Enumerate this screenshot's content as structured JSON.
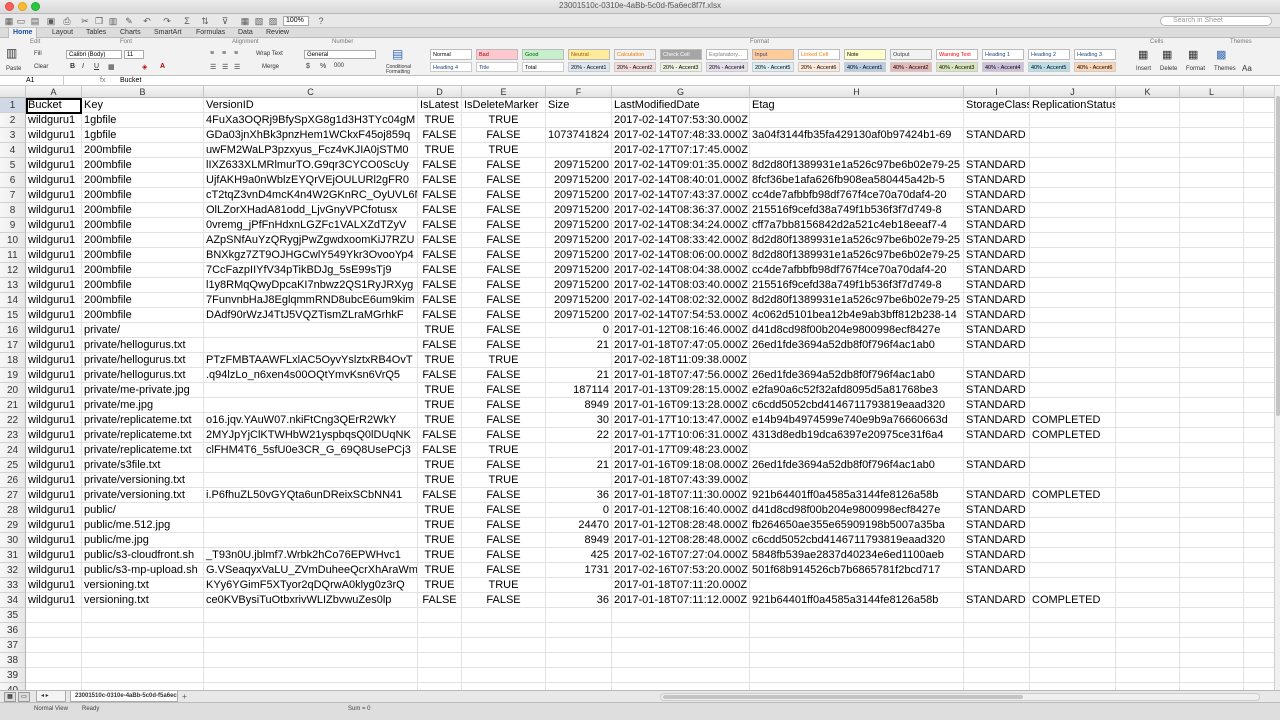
{
  "window": {
    "title": "23001510c-0310e-4aBb-5c0d-f5a6ec8f7f.xlsx"
  },
  "toolbar": {
    "zoom": "100%",
    "search_placeholder": "Search in Sheet"
  },
  "tabs": [
    "Home",
    "Layout",
    "Tables",
    "Charts",
    "SmartArt",
    "Formulas",
    "Data",
    "Review"
  ],
  "ribbon": {
    "groups": [
      "Edit",
      "Font",
      "Alignment",
      "Number",
      "Format",
      "Cells",
      "Themes"
    ],
    "paste": "Paste",
    "fill": "Fill",
    "clear": "Clear",
    "font_name": "Calibri (Body)",
    "font_size": "11",
    "wrap_text": "Wrap Text",
    "merge": "Merge",
    "number_format": "General",
    "conditional": "Conditional Formatting",
    "cells_buttons": [
      "Insert",
      "Delete",
      "Format"
    ],
    "themes_buttons": [
      "Themes",
      "Aa"
    ],
    "styles_top": [
      {
        "label": "Normal",
        "bg": "#ffffff",
        "fg": "#000000"
      },
      {
        "label": "Bad",
        "bg": "#ffc7ce",
        "fg": "#9c0006"
      },
      {
        "label": "Good",
        "bg": "#c6efce",
        "fg": "#006100"
      },
      {
        "label": "Neutral",
        "bg": "#ffeb9c",
        "fg": "#9c5700"
      },
      {
        "label": "Calculation",
        "bg": "#f2f2f2",
        "fg": "#fa7d00"
      },
      {
        "label": "Check Cell",
        "bg": "#a5a5a5",
        "fg": "#ffffff"
      },
      {
        "label": "Explanatory...",
        "bg": "#ffffff",
        "fg": "#7f7f7f"
      },
      {
        "label": "Input",
        "bg": "#ffcc99",
        "fg": "#3f3f76"
      },
      {
        "label": "Linked Cell",
        "bg": "#ffffff",
        "fg": "#fa7d00"
      },
      {
        "label": "Note",
        "bg": "#ffffcc",
        "fg": "#000000"
      },
      {
        "label": "Output",
        "bg": "#f2f2f2",
        "fg": "#3f3f3f"
      },
      {
        "label": "Warning Text",
        "bg": "#ffffff",
        "fg": "#ff0000"
      },
      {
        "label": "Heading 1",
        "bg": "#ffffff",
        "fg": "#1f497d"
      },
      {
        "label": "Heading 2",
        "bg": "#ffffff",
        "fg": "#1f497d"
      },
      {
        "label": "Heading 3",
        "bg": "#ffffff",
        "fg": "#1f497d"
      }
    ],
    "styles_bottom": [
      {
        "label": "Heading 4",
        "bg": "#ffffff",
        "fg": "#1f497d"
      },
      {
        "label": "Title",
        "bg": "#ffffff",
        "fg": "#1f497d"
      },
      {
        "label": "Total",
        "bg": "#ffffff",
        "fg": "#000000"
      },
      {
        "label": "20% - Accent1",
        "bg": "#dce6f1",
        "fg": "#000000"
      },
      {
        "label": "20% - Accent2",
        "bg": "#f2dcdb",
        "fg": "#000000"
      },
      {
        "label": "20% - Accent3",
        "bg": "#ebf1de",
        "fg": "#000000"
      },
      {
        "label": "20% - Accent4",
        "bg": "#e4dfec",
        "fg": "#000000"
      },
      {
        "label": "20% - Accent5",
        "bg": "#daeef3",
        "fg": "#000000"
      },
      {
        "label": "20% - Accent6",
        "bg": "#fde9d9",
        "fg": "#000000"
      },
      {
        "label": "40% - Accent1",
        "bg": "#b8cce4",
        "fg": "#000000"
      },
      {
        "label": "40% - Accent2",
        "bg": "#e6b8b7",
        "fg": "#000000"
      },
      {
        "label": "40% - Accent3",
        "bg": "#d8e4bc",
        "fg": "#000000"
      },
      {
        "label": "40% - Accent4",
        "bg": "#ccc0da",
        "fg": "#000000"
      },
      {
        "label": "40% - Accent5",
        "bg": "#b7dee8",
        "fg": "#000000"
      },
      {
        "label": "40% - Accent6",
        "bg": "#fcd5b4",
        "fg": "#000000"
      }
    ]
  },
  "formula_bar": {
    "name_box": "A1",
    "fx": "fx",
    "value": "Bucket"
  },
  "columns": [
    "A",
    "B",
    "C",
    "D",
    "E",
    "F",
    "G",
    "H",
    "I",
    "J",
    "K",
    "L"
  ],
  "headers": [
    "Bucket",
    "Key",
    "VersionID",
    "IsLatest",
    "IsDeleteMarker",
    "Size",
    "LastModifiedDate",
    "Etag",
    "StorageClass",
    "ReplicationStatus",
    "",
    ""
  ],
  "rows": [
    [
      "wildguru1",
      "1gbfile",
      "4FuXa3OQRj9BfySpXG8g1d3H3TYc04gM",
      "TRUE",
      "TRUE",
      "",
      "2017-02-14T07:53:30.000Z",
      "",
      "",
      ""
    ],
    [
      "wildguru1",
      "1gbfile",
      "GDa03jnXhBk3pnzHem1WCkxF45oj859q",
      "FALSE",
      "FALSE",
      "1073741824",
      "2017-02-14T07:48:33.000Z",
      "3a04f3144fb35fa429130af0b97424b1-69",
      "STANDARD",
      ""
    ],
    [
      "wildguru1",
      "200mbfile",
      "uwFM2WaLP3pzxyus_Fcz4vKJIA0jSTM0",
      "TRUE",
      "TRUE",
      "",
      "2017-02-17T07:17:45.000Z",
      "",
      "",
      ""
    ],
    [
      "wildguru1",
      "200mbfile",
      "lIXZ633XLMRlmurTO.G9qr3CYCO0ScUy",
      "FALSE",
      "FALSE",
      "209715200",
      "2017-02-14T09:01:35.000Z",
      "8d2d80f1389931e1a526c97be6b02e79-25",
      "STANDARD",
      ""
    ],
    [
      "wildguru1",
      "200mbfile",
      "UjfAKH9a0nWblzEYQrVEjOULURl2gFR0",
      "FALSE",
      "FALSE",
      "209715200",
      "2017-02-14T08:40:01.000Z",
      "8fcf36be1afa626fb908ea580445a42b-5",
      "STANDARD",
      ""
    ],
    [
      "wildguru1",
      "200mbfile",
      "cT2tqZ3vnD4mcK4n4W2GKnRC_OyUVL6N",
      "FALSE",
      "FALSE",
      "209715200",
      "2017-02-14T07:43:37.000Z",
      "cc4de7afbbfb98df767f4ce70a70daf4-20",
      "STANDARD",
      ""
    ],
    [
      "wildguru1",
      "200mbfile",
      "OlLZorXHadA81odd_LjvGnyVPCfotusx",
      "FALSE",
      "FALSE",
      "209715200",
      "2017-02-14T08:36:37.000Z",
      "215516f9cefd38a749f1b536f3f7d749-8",
      "STANDARD",
      ""
    ],
    [
      "wildguru1",
      "200mbfile",
      "0vremg_jPfFnHdxnLGZFc1VALXZdTZyV",
      "FALSE",
      "FALSE",
      "209715200",
      "2017-02-14T08:34:24.000Z",
      "cff7a7bb8156842d2a521c4eb18eeaf7-4",
      "STANDARD",
      ""
    ],
    [
      "wildguru1",
      "200mbfile",
      "AZpSNfAuYzQRygjPwZgwdxoomKiJ7RZU",
      "FALSE",
      "FALSE",
      "209715200",
      "2017-02-14T08:33:42.000Z",
      "8d2d80f1389931e1a526c97be6b02e79-25",
      "STANDARD",
      ""
    ],
    [
      "wildguru1",
      "200mbfile",
      "BNXkgz7ZT9OJHGCwlY549Ykr3OvooYp4",
      "FALSE",
      "FALSE",
      "209715200",
      "2017-02-14T08:06:00.000Z",
      "8d2d80f1389931e1a526c97be6b02e79-25",
      "STANDARD",
      ""
    ],
    [
      "wildguru1",
      "200mbfile",
      "7CcFazpIIYfV34pTikBDJg_5sE99sTj9",
      "FALSE",
      "FALSE",
      "209715200",
      "2017-02-14T08:04:38.000Z",
      "cc4de7afbbfb98df767f4ce70a70daf4-20",
      "STANDARD",
      ""
    ],
    [
      "wildguru1",
      "200mbfile",
      "l1y8RMqQwyDpcaKI7nbwz2QS1RyJRXyg",
      "FALSE",
      "FALSE",
      "209715200",
      "2017-02-14T08:03:40.000Z",
      "215516f9cefd38a749f1b536f3f7d749-8",
      "STANDARD",
      ""
    ],
    [
      "wildguru1",
      "200mbfile",
      "7FunvnbHaJ8EglqmmRND8ubcE6um9kim",
      "FALSE",
      "FALSE",
      "209715200",
      "2017-02-14T08:02:32.000Z",
      "8d2d80f1389931e1a526c97be6b02e79-25",
      "STANDARD",
      ""
    ],
    [
      "wildguru1",
      "200mbfile",
      "DAdf90rWzJ4TtJ5VQZTismZLraMGrhkF",
      "FALSE",
      "FALSE",
      "209715200",
      "2017-02-14T07:54:53.000Z",
      "4c062d5101bea12b4e9ab3bff812b238-14",
      "STANDARD",
      ""
    ],
    [
      "wildguru1",
      "private/",
      "",
      "TRUE",
      "FALSE",
      "0",
      "2017-01-12T08:16:46.000Z",
      "d41d8cd98f00b204e9800998ecf8427e",
      "STANDARD",
      ""
    ],
    [
      "wildguru1",
      "private/hellogurus.txt",
      "",
      "FALSE",
      "FALSE",
      "21",
      "2017-01-18T07:47:05.000Z",
      "26ed1fde3694a52db8f0f796f4ac1ab0",
      "STANDARD",
      ""
    ],
    [
      "wildguru1",
      "private/hellogurus.txt",
      "PTzFMBTAAWFLxlAC5OyvYslztxRB4OvT",
      "TRUE",
      "TRUE",
      "",
      "2017-02-18T11:09:38.000Z",
      "",
      "",
      ""
    ],
    [
      "wildguru1",
      "private/hellogurus.txt",
      ".q94lzLo_n6xen4s00OQtYmvKsn6VrQ5",
      "FALSE",
      "FALSE",
      "21",
      "2017-01-18T07:47:56.000Z",
      "26ed1fde3694a52db8f0f796f4ac1ab0",
      "STANDARD",
      ""
    ],
    [
      "wildguru1",
      "private/me-private.jpg",
      "",
      "TRUE",
      "FALSE",
      "187114",
      "2017-01-13T09:28:15.000Z",
      "e2fa90a6c52f32afd8095d5a81768be3",
      "STANDARD",
      ""
    ],
    [
      "wildguru1",
      "private/me.jpg",
      "",
      "TRUE",
      "FALSE",
      "8949",
      "2017-01-16T09:13:28.000Z",
      "c6cdd5052cbd4146711793819eaad320",
      "STANDARD",
      ""
    ],
    [
      "wildguru1",
      "private/replicateme.txt",
      "o16.jqv.YAuW07.nkiFtCng3QErR2WkY",
      "TRUE",
      "FALSE",
      "30",
      "2017-01-17T10:13:47.000Z",
      "e14b94b4974599e740e9b9a76660663d",
      "STANDARD",
      "COMPLETED"
    ],
    [
      "wildguru1",
      "private/replicateme.txt",
      "2MYJpYjClKTWHbW21yspbqsQ0lDUqNK",
      "FALSE",
      "FALSE",
      "22",
      "2017-01-17T10:06:31.000Z",
      "4313d8edb19dca6397e20975ce31f6a4",
      "STANDARD",
      "COMPLETED"
    ],
    [
      "wildguru1",
      "private/replicateme.txt",
      "clFHM4T6_5sfU0e3CR_G_69Q8UsePCj3",
      "FALSE",
      "TRUE",
      "",
      "2017-01-17T09:48:23.000Z",
      "",
      "",
      ""
    ],
    [
      "wildguru1",
      "private/s3file.txt",
      "",
      "TRUE",
      "FALSE",
      "21",
      "2017-01-16T09:18:08.000Z",
      "26ed1fde3694a52db8f0f796f4ac1ab0",
      "STANDARD",
      ""
    ],
    [
      "wildguru1",
      "private/versioning.txt",
      "",
      "TRUE",
      "TRUE",
      "",
      "2017-01-18T07:43:39.000Z",
      "",
      "",
      ""
    ],
    [
      "wildguru1",
      "private/versioning.txt",
      "i.P6fhuZL50vGYQta6unDReixSCbNN41",
      "FALSE",
      "FALSE",
      "36",
      "2017-01-18T07:11:30.000Z",
      "921b64401ff0a4585a3144fe8126a58b",
      "STANDARD",
      "COMPLETED"
    ],
    [
      "wildguru1",
      "public/",
      "",
      "TRUE",
      "FALSE",
      "0",
      "2017-01-12T08:16:40.000Z",
      "d41d8cd98f00b204e9800998ecf8427e",
      "STANDARD",
      ""
    ],
    [
      "wildguru1",
      "public/me.512.jpg",
      "",
      "TRUE",
      "FALSE",
      "24470",
      "2017-01-12T08:28:48.000Z",
      "fb264650ae355e65909198b5007a35ba",
      "STANDARD",
      ""
    ],
    [
      "wildguru1",
      "public/me.jpg",
      "",
      "TRUE",
      "FALSE",
      "8949",
      "2017-01-12T08:28:48.000Z",
      "c6cdd5052cbd4146711793819eaad320",
      "STANDARD",
      ""
    ],
    [
      "wildguru1",
      "public/s3-cloudfront.sh",
      "_T93n0U.jblmf7.Wrbk2hCo76EPWHvc1",
      "TRUE",
      "FALSE",
      "425",
      "2017-02-16T07:27:04.000Z",
      "5848fb539ae2837d40234e6ed1100aeb",
      "STANDARD",
      ""
    ],
    [
      "wildguru1",
      "public/s3-mp-upload.sh",
      "G.VSeaqyxVaLU_ZVmDuheeQcrXhAraWm",
      "TRUE",
      "FALSE",
      "1731",
      "2017-02-16T07:53:20.000Z",
      "501f68b914526cb7b6865781f2bcd717",
      "STANDARD",
      ""
    ],
    [
      "wildguru1",
      "versioning.txt",
      "KYy6YGimF5XTyor2qDQrwA0klyg0z3rQ",
      "TRUE",
      "TRUE",
      "",
      "2017-01-18T07:11:20.000Z",
      "",
      "",
      ""
    ],
    [
      "wildguru1",
      "versioning.txt",
      "ce0KVBysiTuOtbxrivWLIZbvwuZes0lp",
      "FALSE",
      "FALSE",
      "36",
      "2017-01-18T07:11:12.000Z",
      "921b64401ff0a4585a3144fe8126a58b",
      "STANDARD",
      "COMPLETED"
    ]
  ],
  "empty_row_count": 6,
  "sheet_tab": "23001510c-0310e-4aBb-5c0d-f5a6ec8f",
  "status": {
    "view": "Normal View",
    "state": "Ready",
    "sum": "Sum = 0"
  }
}
